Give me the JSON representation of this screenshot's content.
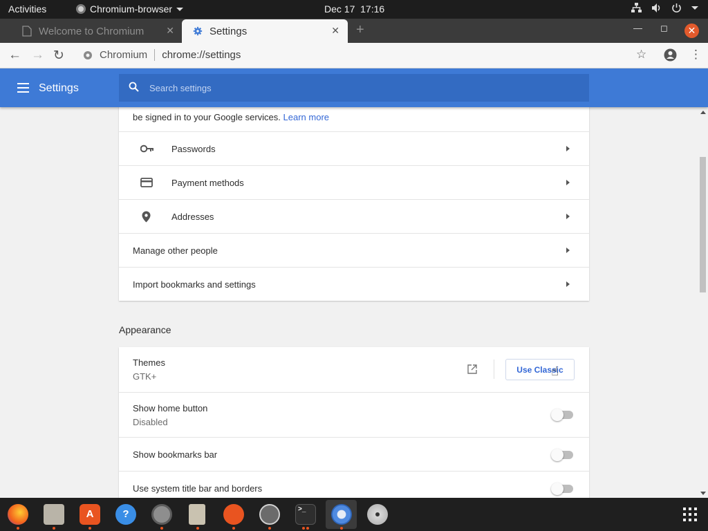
{
  "topbar": {
    "activities": "Activities",
    "app_name": "Chromium-browser",
    "date": "Dec 17",
    "time": "17:16",
    "tray_icons": [
      "network-icon",
      "volume-icon",
      "power-icon",
      "chevron-down-icon"
    ]
  },
  "tabs": [
    {
      "title": "Welcome to Chromium",
      "active": false,
      "icon": "page-icon"
    },
    {
      "title": "Settings",
      "active": true,
      "icon": "gear-icon"
    }
  ],
  "toolbar": {
    "site_label": "Chromium",
    "url": "chrome://settings"
  },
  "settings_header": {
    "title": "Settings",
    "search_placeholder": "Search settings"
  },
  "autofill_card": {
    "partial_text": "be signed in to your Google services.",
    "learn_more": "Learn more",
    "rows": [
      {
        "label": "Passwords",
        "icon": "key-icon"
      },
      {
        "label": "Payment methods",
        "icon": "credit-card-icon"
      },
      {
        "label": "Addresses",
        "icon": "location-pin-icon"
      },
      {
        "label": "Manage other people"
      },
      {
        "label": "Import bookmarks and settings"
      }
    ]
  },
  "appearance": {
    "section_title": "Appearance",
    "themes_label": "Themes",
    "themes_value": "GTK+",
    "use_classic": "Use Classic",
    "home_button_label": "Show home button",
    "home_button_status": "Disabled",
    "bookmarks_bar_label": "Show bookmarks bar",
    "system_titlebar_label": "Use system title bar and borders",
    "toggles": {
      "home_button": false,
      "bookmarks_bar": false,
      "system_titlebar": false
    }
  },
  "dock": [
    {
      "name": "firefox-icon",
      "running": true
    },
    {
      "name": "files-icon",
      "running": true
    },
    {
      "name": "software-center-icon",
      "running": true
    },
    {
      "name": "help-icon",
      "running": false
    },
    {
      "name": "settings-icon",
      "running": true
    },
    {
      "name": "text-editor-icon",
      "running": true
    },
    {
      "name": "ubuntu-icon",
      "running": true
    },
    {
      "name": "updater-icon",
      "running": true
    },
    {
      "name": "terminal-icon",
      "running": true
    },
    {
      "name": "chromium-icon",
      "running": true
    },
    {
      "name": "disc-icon",
      "running": false
    },
    {
      "name": "show-apps-icon",
      "running": false
    }
  ],
  "colors": {
    "settings_blue": "#3e7ad6",
    "search_blue": "#336bc2",
    "link_blue": "#3367d6",
    "ubuntu_orange": "#e95420",
    "close_orange": "#e35a2c"
  }
}
